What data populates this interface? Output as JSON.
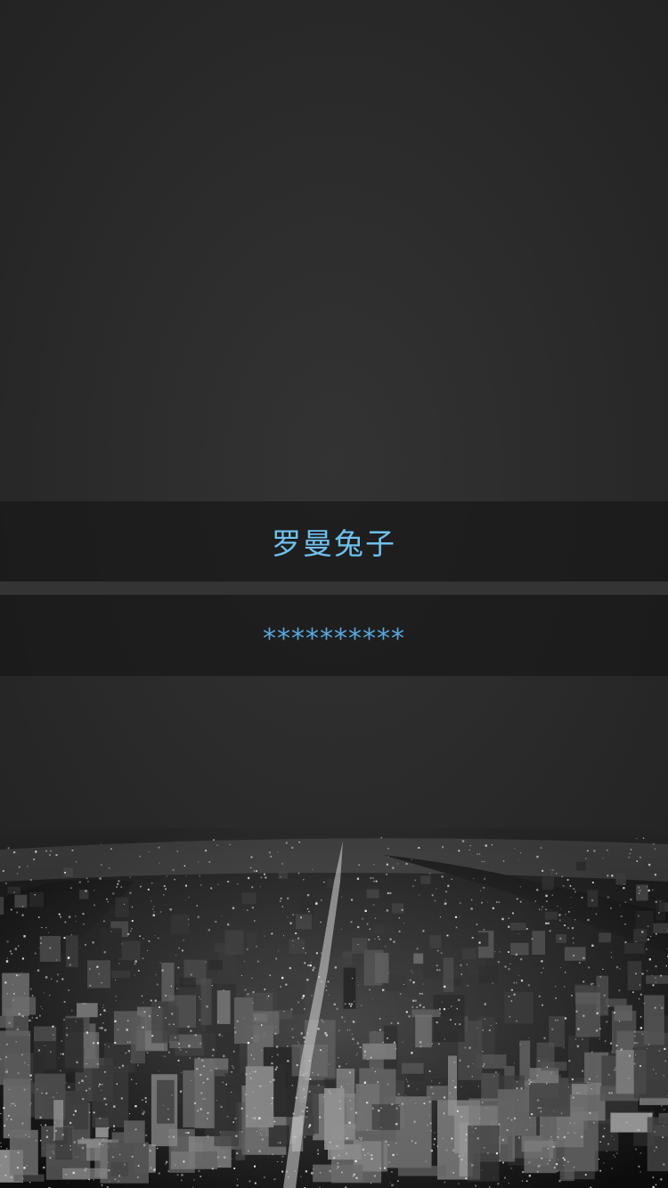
{
  "login": {
    "username_value": "罗曼兔子",
    "password_value": "**********"
  },
  "colors": {
    "background": "#2a2a2a",
    "field_background": "#181818",
    "field_text": "#6fc0ee"
  },
  "background_image": {
    "icon": "night-city-skyline-photo"
  }
}
